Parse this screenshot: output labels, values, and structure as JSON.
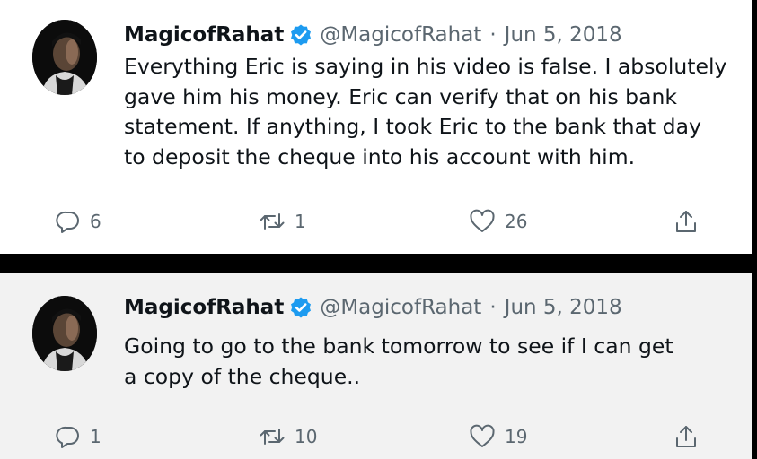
{
  "tweets": [
    {
      "author": "MagicofRahat",
      "handle": "@MagicofRahat",
      "separator": "·",
      "date": "Jun 5, 2018",
      "text_lines": [
        "Everything Eric is saying in his video is false. I absolutely",
        "gave him his money. Eric can verify that on his bank",
        "statement. If anything, I took Eric to the bank that day",
        "to deposit the cheque into his account with him."
      ],
      "replies": "6",
      "retweets": "1",
      "likes": "26"
    },
    {
      "author": "MagicofRahat",
      "handle": "@MagicofRahat",
      "separator": "·",
      "date": "Jun 5, 2018",
      "text_lines": [
        "Going to go to the bank tomorrow to see if I can get",
        "a copy of the cheque.."
      ],
      "replies": "1",
      "retweets": "10",
      "likes": "19"
    }
  ],
  "icons": {
    "verified": "verified-badge-icon",
    "reply": "reply-icon",
    "retweet": "retweet-icon",
    "like": "heart-icon",
    "share": "share-icon"
  },
  "colors": {
    "verified_blue": "#1d9bf0",
    "text": "#0f1419",
    "muted": "#5b6770",
    "card_background": "#ffffff",
    "divider_background": "#000000"
  }
}
